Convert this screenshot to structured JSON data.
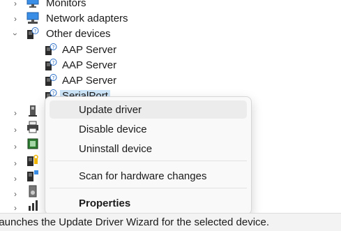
{
  "tree": {
    "monitors": "Monitors",
    "network_adapters": "Network adapters",
    "other_devices": "Other devices",
    "children": [
      "AAP Server",
      "AAP Server",
      "AAP Server",
      "SerialPort"
    ]
  },
  "context_menu": {
    "update_driver": "Update driver",
    "disable_device": "Disable device",
    "uninstall_device": "Uninstall device",
    "scan_hardware": "Scan for hardware changes",
    "properties": "Properties"
  },
  "status_bar": {
    "text": "Launches the Update Driver Wizard for the selected device."
  },
  "icons": {
    "monitor": "monitor-icon",
    "network": "network-adapter-icon",
    "unknown_device": "unknown-device-icon"
  }
}
